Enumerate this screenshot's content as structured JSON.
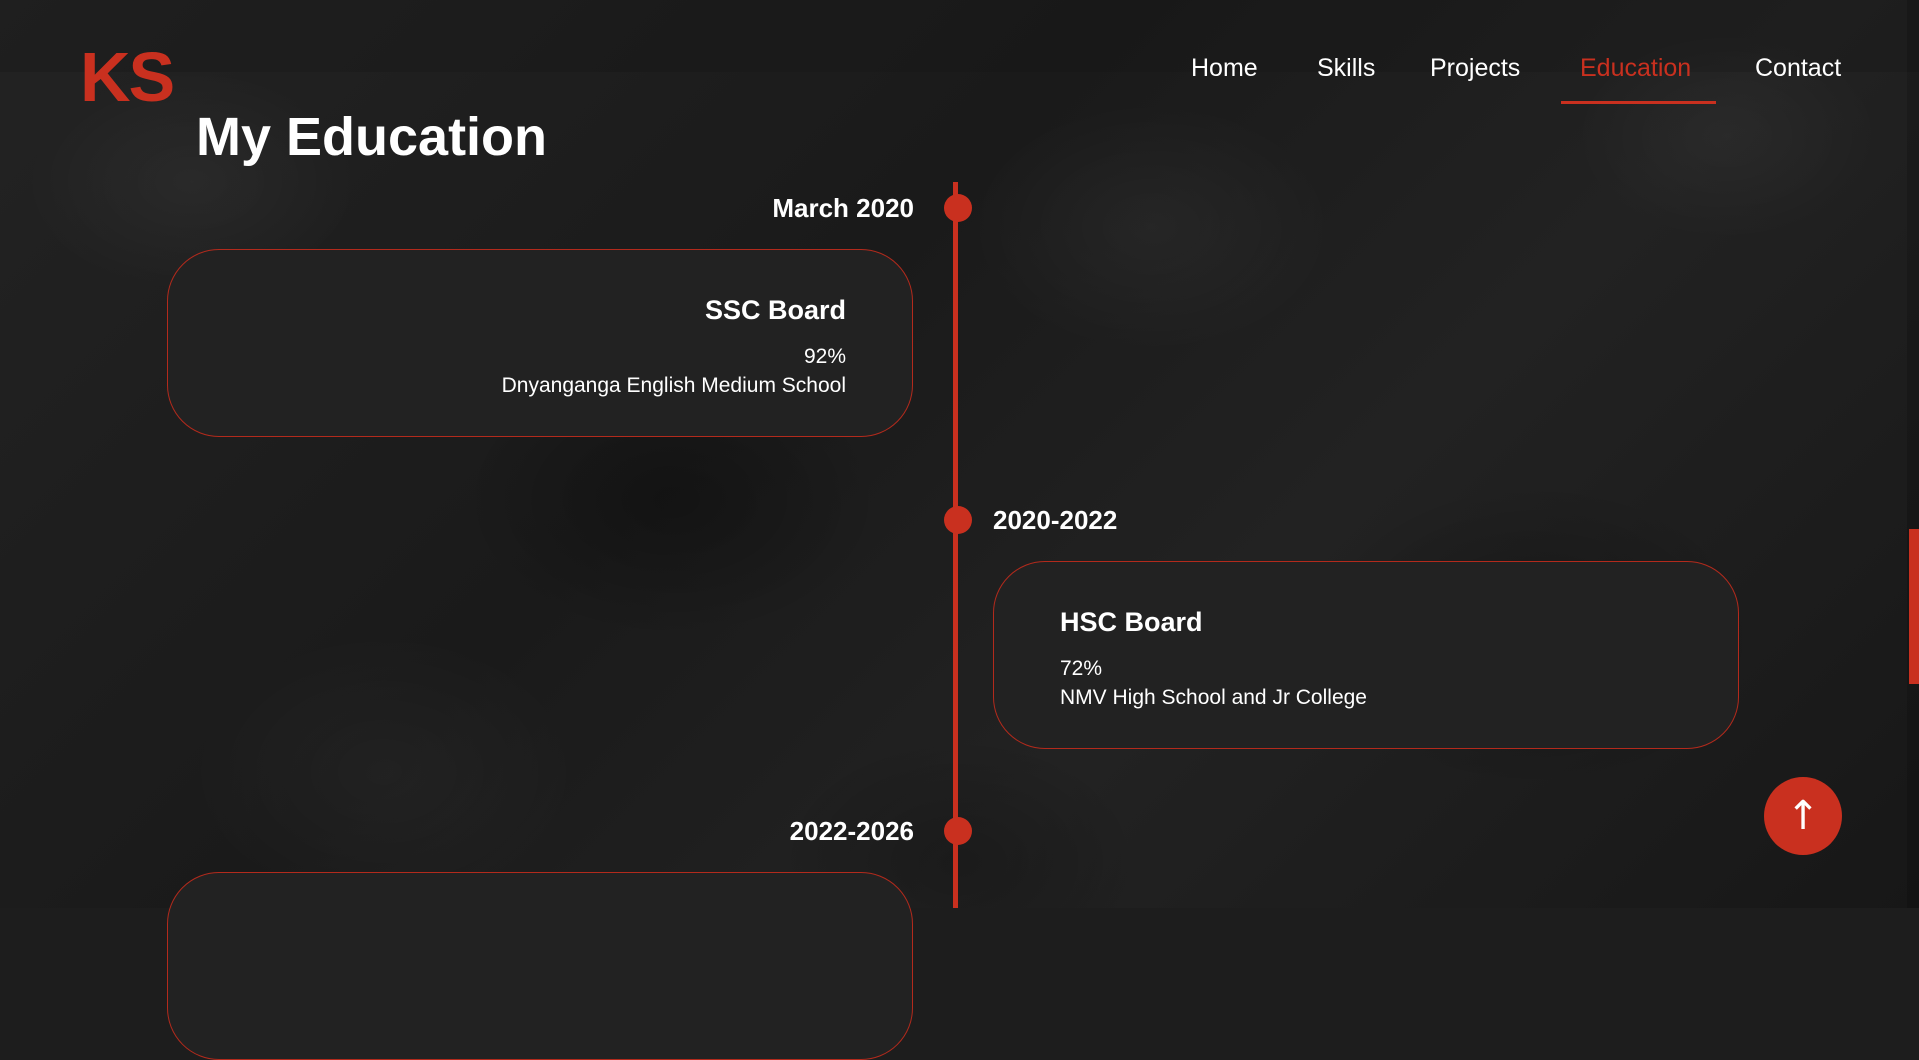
{
  "brand": {
    "logo": "KS",
    "accent_color": "#c9301f"
  },
  "nav": {
    "items": [
      {
        "label": "Home",
        "active": false
      },
      {
        "label": "Skills",
        "active": false
      },
      {
        "label": "Projects",
        "active": false
      },
      {
        "label": "Education",
        "active": true
      },
      {
        "label": "Contact",
        "active": false
      }
    ]
  },
  "page": {
    "title": "My Education"
  },
  "timeline": [
    {
      "date": "March 2020",
      "title": "SSC Board",
      "score": "92%",
      "school": "Dnyanganga English Medium School"
    },
    {
      "date": "2020-2022",
      "title": "HSC Board",
      "score": "72%",
      "school": "NMV High School and Jr College"
    },
    {
      "date": "2022-2026"
    }
  ],
  "scroll_top_button": {
    "icon": "arrow-up-icon",
    "glyph": "↑"
  }
}
